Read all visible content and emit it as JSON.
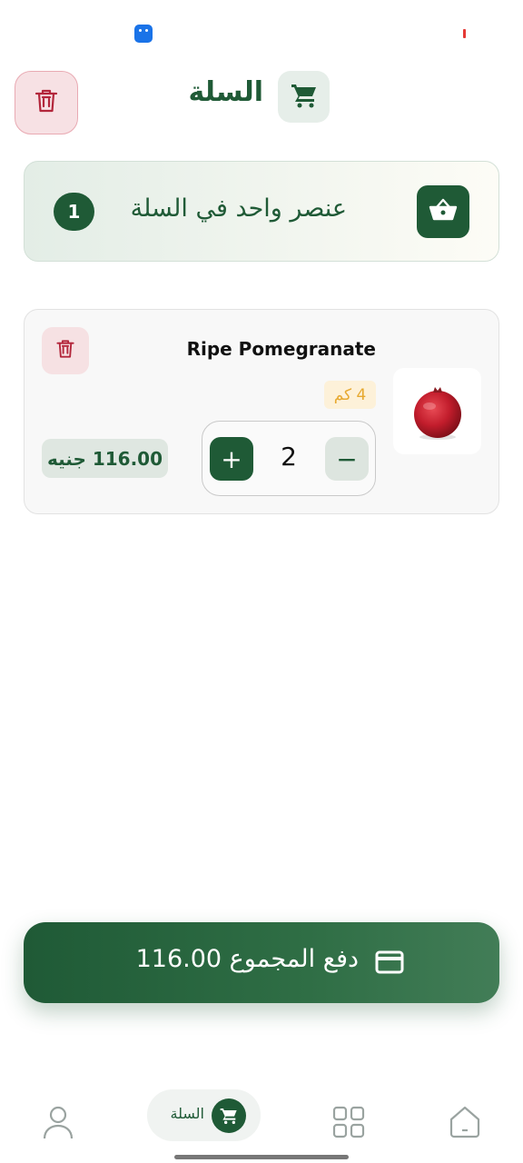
{
  "header": {
    "title": "السلة"
  },
  "summary": {
    "count": "1",
    "text": "عنصر واحد في السلة"
  },
  "cart_items": [
    {
      "name": "Ripe Pomegranate",
      "distance": "4 كم",
      "quantity": "2",
      "price": "116.00 جنيه"
    }
  ],
  "checkout": {
    "label": "دفع المجموع 116.00"
  },
  "bottom_nav": {
    "cart_label": "السلة"
  },
  "colors": {
    "primary": "#1f5a36",
    "danger": "#b3263b",
    "accent_orange": "#e7a930"
  }
}
